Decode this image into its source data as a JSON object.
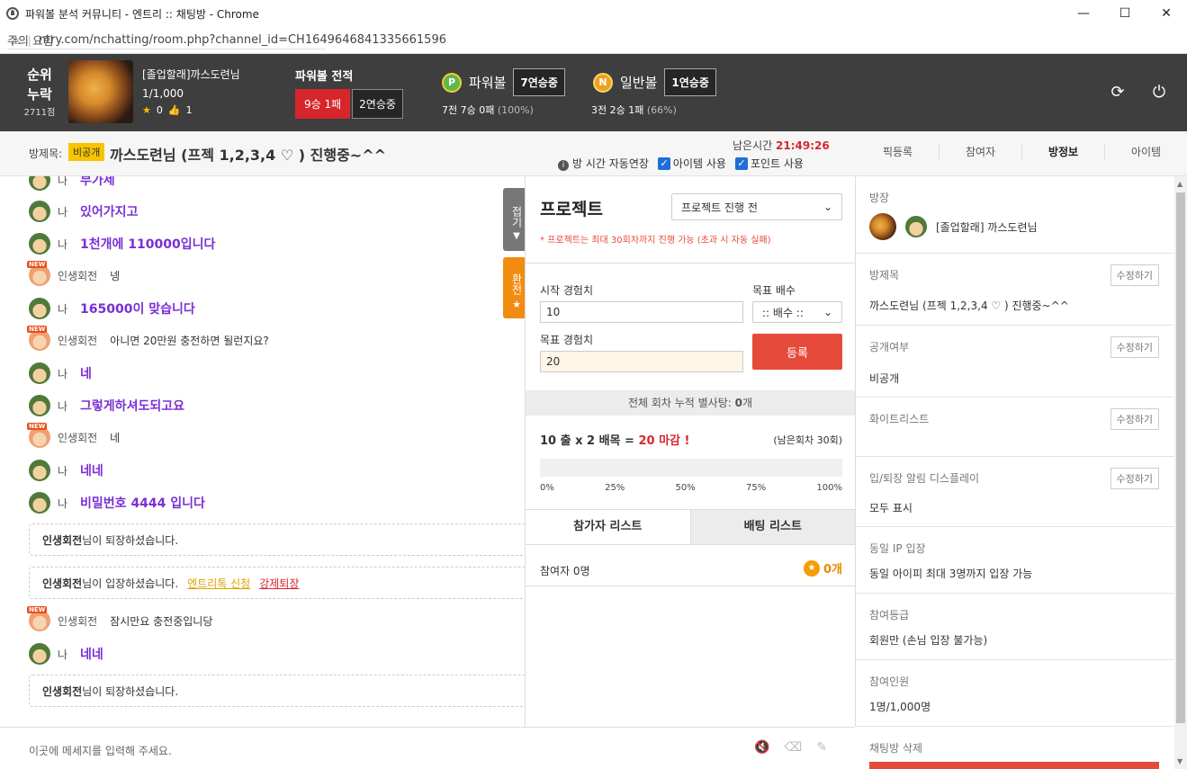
{
  "window": {
    "title": "파워볼 분석 커뮤니티 - 엔트리 :: 채팅방 - Chrome",
    "min": "—",
    "max": "☐",
    "close": "✕"
  },
  "address": {
    "security": "주의 요함",
    "url": "ntry.com/nchatting/room.php?channel_id=CH1649646841335661596"
  },
  "top": {
    "rank_label": "순위\n누락",
    "rank_line1": "순위",
    "rank_line2": "누락",
    "points": "2711점",
    "user_name": "[졸업할래]까스도련님",
    "user_count": "1/1,000",
    "stars": "0",
    "likes": "1",
    "record_title": "파워볼 전적",
    "record_win": "9승 1패",
    "record_streak": "2연승중",
    "powerball_label": "파워볼",
    "powerball_streak": "7연승중",
    "powerball_stats": "7전 7승 0패",
    "powerball_pct": "(100%)",
    "normal_label": "일반볼",
    "normal_streak": "1연승중",
    "normal_stats": "3전 2승 1패",
    "normal_pct": "(66%)"
  },
  "room": {
    "title_label": "방제목:",
    "private_badge": "비공개",
    "title": "까스도련님 (프젝 1,2,3,4 ♡ ) 진행중~^^",
    "remain_label": "남은시간",
    "remain_time": "21:49:26",
    "auto_extend": "방 시간 자동연장",
    "item_use": "아이템 사용",
    "point_use": "포인트 사용",
    "tabs": [
      "픽등록",
      "참여자",
      "방정보",
      "아이템"
    ]
  },
  "chat": {
    "me": "나",
    "other": "인생회전",
    "messages": [
      {
        "kind": "me",
        "text": "부가세"
      },
      {
        "kind": "me",
        "text": "있어가지고"
      },
      {
        "kind": "me",
        "text": "1천개에 110000입니다"
      },
      {
        "kind": "other",
        "text": "넹"
      },
      {
        "kind": "me",
        "text": "165000이 맞습니다"
      },
      {
        "kind": "other",
        "text": "아니면 20만원 충전하면 될런지요?"
      },
      {
        "kind": "me",
        "text": "네"
      },
      {
        "kind": "me",
        "text": "그렇게하셔도되고요"
      },
      {
        "kind": "other",
        "text": "네"
      },
      {
        "kind": "me",
        "text": "네네"
      },
      {
        "kind": "me",
        "text": "비밀번호 4444 입니다"
      }
    ],
    "sys1_name": "인생회전",
    "sys1_text": "님이 퇴장하셨습니다.",
    "sys2_name": "인생회전",
    "sys2_text": "님이 입장하셨습니다.",
    "sys2_link1": "엔트리톡 신청",
    "sys2_link2": "강제퇴장",
    "msg_after1": "잠시만요 충전중입니당",
    "msg_after2": "네네",
    "sys3_name": "인생회전",
    "sys3_text": "님이 퇴장하셨습니다.",
    "fold_label": "접기",
    "exchange_label": "환전",
    "input_placeholder": "이곳에 메세지를 입력해 주세요."
  },
  "project": {
    "title": "프로젝트",
    "status_select": "프로젝트 진행 전",
    "note": "* 프로젝트는 최대 30회차까지 진행 가능 (초과 시 자동 실패)",
    "start_label": "시작 경험치",
    "start_value": "10",
    "target_multi_label": "목표 배수",
    "target_multi_select": ":: 배수 ::",
    "target_label": "목표 경험치",
    "target_value": "20",
    "register": "등록",
    "accum": "전체 회차 누적 별사탕: 0개",
    "accum_prefix": "전체 회차 누적 별사탕: ",
    "accum_num": "0",
    "accum_unit": "개",
    "formula_a": "10 출 x 2 배목 = ",
    "formula_b": "20 마감 !",
    "remain_round": "(남은회차 30회)",
    "progress": 0,
    "ticks": [
      "0%",
      "25%",
      "50%",
      "75%",
      "100%"
    ],
    "tab_participants": "참가자 리스트",
    "tab_bets": "배팅 리스트",
    "participants": "참여자 0명",
    "coin_count": "0개"
  },
  "side": {
    "host_label": "방장",
    "host_name": "[졸업할래] 까스도련님",
    "title_label": "방제목",
    "title_value": "까스도련님 (프젝 1,2,3,4 ♡ ) 진행중~^^",
    "edit": "수정하기",
    "public_label": "공개여부",
    "public_value": "비공개",
    "white_label": "화이트리스트",
    "display_label": "입/퇴장 알림 디스플레이",
    "display_value": "모두 표시",
    "ip_label": "동일 IP 입장",
    "ip_value": "동일 아이피 최대 3명까지 입장 가능",
    "grade_label": "참여등급",
    "grade_value": "회원만 (손님 입장 불가능)",
    "count_label": "참여인원",
    "count_value": "1명/1,000명",
    "delete_label": "채팅방 삭제"
  },
  "colors": {
    "accent_red": "#e64a3b",
    "purple": "#7a2fd6",
    "topbar": "#3e3e3e",
    "badge_yellow": "#f8c400"
  },
  "icons": [
    "refresh-icon",
    "power-icon",
    "star-icon",
    "thumb-icon",
    "mute-icon",
    "eraser-icon",
    "magic-icon"
  ]
}
